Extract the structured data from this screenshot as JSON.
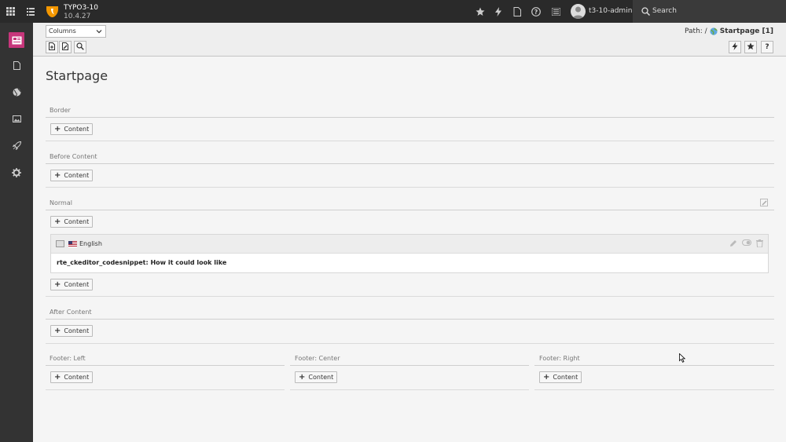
{
  "topbar": {
    "site_name": "TYPO3-10",
    "site_version": "10.4.27",
    "username": "t3-10-admin",
    "search_label": "Search",
    "icons": [
      "grid-icon",
      "list-icon",
      "star-icon",
      "bolt-icon",
      "document-icon",
      "help-icon",
      "list-icon",
      "user-icon",
      "search-icon"
    ]
  },
  "modules": [
    "page-module-icon",
    "file-icon",
    "globe-icon",
    "image-icon",
    "rocket-icon",
    "gear-icon"
  ],
  "docheader": {
    "view_select": "Columns",
    "path_label": "Path: /",
    "path_page": "Startpage [1]"
  },
  "page": {
    "title": "Startpage",
    "columns": {
      "border": "Border",
      "before": "Before Content",
      "normal": "Normal",
      "after": "After Content",
      "footer_left": "Footer: Left",
      "footer_center": "Footer: Center",
      "footer_right": "Footer: Right"
    },
    "content_button": "Content",
    "content_element": {
      "language": "English",
      "text": "rte_ckeditor_codesnippet: How it could look like"
    }
  },
  "colors": {
    "topbar": "#2a2a2a",
    "module_menu": "#333333",
    "active_module": "#c7367b",
    "typo3_orange": "#f49700"
  }
}
